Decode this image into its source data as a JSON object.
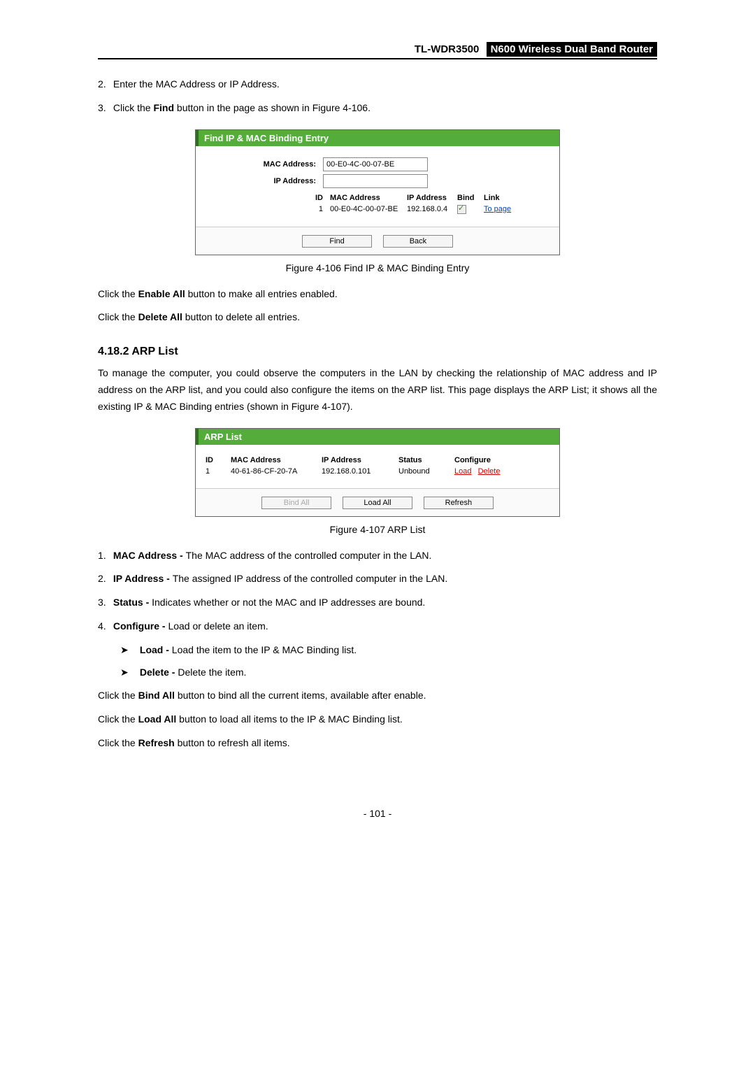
{
  "header": {
    "model": "TL-WDR3500",
    "title": "N600 Wireless Dual Band Router"
  },
  "list1": {
    "item2_num": "2.",
    "item2_text": "Enter the MAC Address or IP Address.",
    "item3_num": "3.",
    "item3_prefix": "Click the ",
    "item3_bold": "Find",
    "item3_suffix": " button in the page as shown in Figure 4-106."
  },
  "fig106": {
    "title": "Find IP & MAC Binding Entry",
    "mac_label": "MAC Address:",
    "mac_value": "00-E0-4C-00-07-BE",
    "ip_label": "IP Address:",
    "ip_value": "",
    "cols": {
      "id": "ID",
      "mac": "MAC Address",
      "ip": "IP Address",
      "bind": "Bind",
      "link": "Link"
    },
    "row": {
      "id": "1",
      "mac": "00-E0-4C-00-07-BE",
      "ip": "192.168.0.4",
      "link_text": "To page"
    },
    "buttons": {
      "find": "Find",
      "back": "Back"
    },
    "caption": "Figure 4-106 Find IP & MAC Binding Entry"
  },
  "mid": {
    "enable_pre": "Click the ",
    "enable_b": "Enable All",
    "enable_post": " button to make all entries enabled.",
    "delete_pre": "Click the ",
    "delete_b": "Delete All",
    "delete_post": " button to delete all entries."
  },
  "section": {
    "heading": "4.18.2  ARP List",
    "para": "To manage the computer, you could observe the computers in the LAN by checking the relationship of MAC address and IP address on the ARP list, and you could also configure the items on the ARP list. This page displays the ARP List; it shows all the existing IP & MAC Binding entries (shown in Figure 4-107)."
  },
  "fig107": {
    "title": "ARP List",
    "cols": {
      "id": "ID",
      "mac": "MAC Address",
      "ip": "IP Address",
      "status": "Status",
      "configure": "Configure"
    },
    "row": {
      "id": "1",
      "mac": "40-61-86-CF-20-7A",
      "ip": "192.168.0.101",
      "status": "Unbound",
      "load": "Load",
      "delete": "Delete"
    },
    "buttons": {
      "bind": "Bind All",
      "load": "Load All",
      "refresh": "Refresh"
    },
    "caption": "Figure 4-107 ARP List"
  },
  "defs": {
    "i1_num": "1.",
    "i1_b": "MAC Address - ",
    "i1_t": "The MAC address of the controlled computer in the LAN.",
    "i2_num": "2.",
    "i2_b": "IP Address - ",
    "i2_t": "The assigned IP address of the controlled computer in the LAN.",
    "i3_num": "3.",
    "i3_b": "Status - ",
    "i3_t": "Indicates whether or not the MAC and IP addresses are bound.",
    "i4_num": "4.",
    "i4_b": "Configure - ",
    "i4_t": "Load or delete an item.",
    "s1_arrow": "➤",
    "s1_b": "Load - ",
    "s1_t": "Load the item to the IP & MAC Binding list.",
    "s2_arrow": "➤",
    "s2_b": "Delete - ",
    "s2_t": "Delete the item."
  },
  "tail": {
    "bind_pre": "Click the ",
    "bind_b": "Bind All",
    "bind_post": " button to bind all the current items, available after enable.",
    "load_pre": "Click the ",
    "load_b": "Load All",
    "load_post": " button to load all items to the IP & MAC Binding list.",
    "refresh_pre": "Click the ",
    "refresh_b": "Refresh",
    "refresh_post": " button to refresh all items."
  },
  "footer": {
    "page": "- 101 -"
  }
}
